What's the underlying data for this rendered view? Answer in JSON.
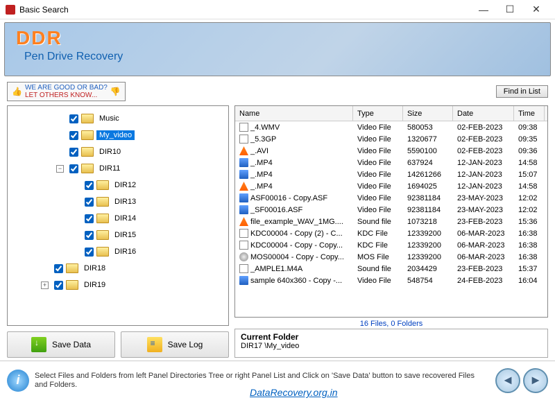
{
  "window": {
    "title": "Basic Search"
  },
  "header": {
    "brand": "DDR",
    "subtitle": "Pen Drive Recovery"
  },
  "toolbar": {
    "feedback_l1": "WE ARE GOOD OR BAD?",
    "feedback_l2": "LET OTHERS KNOW...",
    "find_label": "Find in List"
  },
  "tree": {
    "items": [
      {
        "indent": 3,
        "expander": "none",
        "checked": true,
        "label": "Music",
        "selected": false
      },
      {
        "indent": 3,
        "expander": "none",
        "checked": true,
        "label": "My_video",
        "selected": true
      },
      {
        "indent": 3,
        "expander": "none",
        "checked": true,
        "label": "DIR10",
        "selected": false
      },
      {
        "indent": 3,
        "expander": "minus",
        "checked": true,
        "label": "DIR11",
        "selected": false
      },
      {
        "indent": 4,
        "expander": "none",
        "checked": true,
        "label": "DIR12",
        "selected": false
      },
      {
        "indent": 4,
        "expander": "none",
        "checked": true,
        "label": "DIR13",
        "selected": false
      },
      {
        "indent": 4,
        "expander": "none",
        "checked": true,
        "label": "DIR14",
        "selected": false
      },
      {
        "indent": 4,
        "expander": "none",
        "checked": true,
        "label": "DIR15",
        "selected": false
      },
      {
        "indent": 4,
        "expander": "none",
        "checked": true,
        "label": "DIR16",
        "selected": false
      },
      {
        "indent": 2,
        "expander": "none",
        "checked": true,
        "label": "DIR18",
        "selected": false
      },
      {
        "indent": 2,
        "expander": "plus",
        "checked": true,
        "label": "DIR19",
        "selected": false
      }
    ]
  },
  "actions": {
    "save_data": "Save Data",
    "save_log": "Save Log"
  },
  "columns": {
    "name": "Name",
    "type": "Type",
    "size": "Size",
    "date": "Date",
    "time": "Time"
  },
  "files": [
    {
      "icon": "doc",
      "name": "_4.WMV",
      "type": "Video File",
      "size": "580053",
      "date": "02-FEB-2023",
      "time": "09:38"
    },
    {
      "icon": "doc",
      "name": "_5.3GP",
      "type": "Video File",
      "size": "1320677",
      "date": "02-FEB-2023",
      "time": "09:35"
    },
    {
      "icon": "vlc",
      "name": "_.AVI",
      "type": "Video File",
      "size": "5590100",
      "date": "02-FEB-2023",
      "time": "09:36"
    },
    {
      "icon": "blue",
      "name": "_.MP4",
      "type": "Video File",
      "size": "637924",
      "date": "12-JAN-2023",
      "time": "14:58"
    },
    {
      "icon": "blue",
      "name": "_.MP4",
      "type": "Video File",
      "size": "14261266",
      "date": "12-JAN-2023",
      "time": "15:07"
    },
    {
      "icon": "vlc",
      "name": "_.MP4",
      "type": "Video File",
      "size": "1694025",
      "date": "12-JAN-2023",
      "time": "14:58"
    },
    {
      "icon": "blue",
      "name": "ASF00016 - Copy.ASF",
      "type": "Video File",
      "size": "92381184",
      "date": "23-MAY-2023",
      "time": "12:02"
    },
    {
      "icon": "blue",
      "name": "_SF00016.ASF",
      "type": "Video File",
      "size": "92381184",
      "date": "23-MAY-2023",
      "time": "12:02"
    },
    {
      "icon": "vlc",
      "name": "file_example_WAV_1MG....",
      "type": "Sound file",
      "size": "1073218",
      "date": "23-FEB-2023",
      "time": "15:36"
    },
    {
      "icon": "doc",
      "name": "KDC00004 - Copy (2) - C...",
      "type": "KDC File",
      "size": "12339200",
      "date": "06-MAR-2023",
      "time": "16:38"
    },
    {
      "icon": "doc",
      "name": "KDC00004 - Copy - Copy...",
      "type": "KDC File",
      "size": "12339200",
      "date": "06-MAR-2023",
      "time": "16:38"
    },
    {
      "icon": "disc",
      "name": "MOS00004 - Copy - Copy...",
      "type": "MOS File",
      "size": "12339200",
      "date": "06-MAR-2023",
      "time": "16:38"
    },
    {
      "icon": "doc",
      "name": "_AMPLE1.M4A",
      "type": "Sound file",
      "size": "2034429",
      "date": "23-FEB-2023",
      "time": "15:37"
    },
    {
      "icon": "blue",
      "name": "sample 640x360 - Copy -...",
      "type": "Video File",
      "size": "548754",
      "date": "24-FEB-2023",
      "time": "16:04"
    }
  ],
  "status": "16 Files, 0 Folders",
  "current_folder": {
    "title": "Current Folder",
    "path": "DIR17 \\My_video"
  },
  "footer": {
    "tip": "Select Files and Folders from left Panel Directories Tree or right Panel List and Click on 'Save Data' button to save recovered Files and Folders.",
    "site": "DataRecovery.org.in"
  }
}
